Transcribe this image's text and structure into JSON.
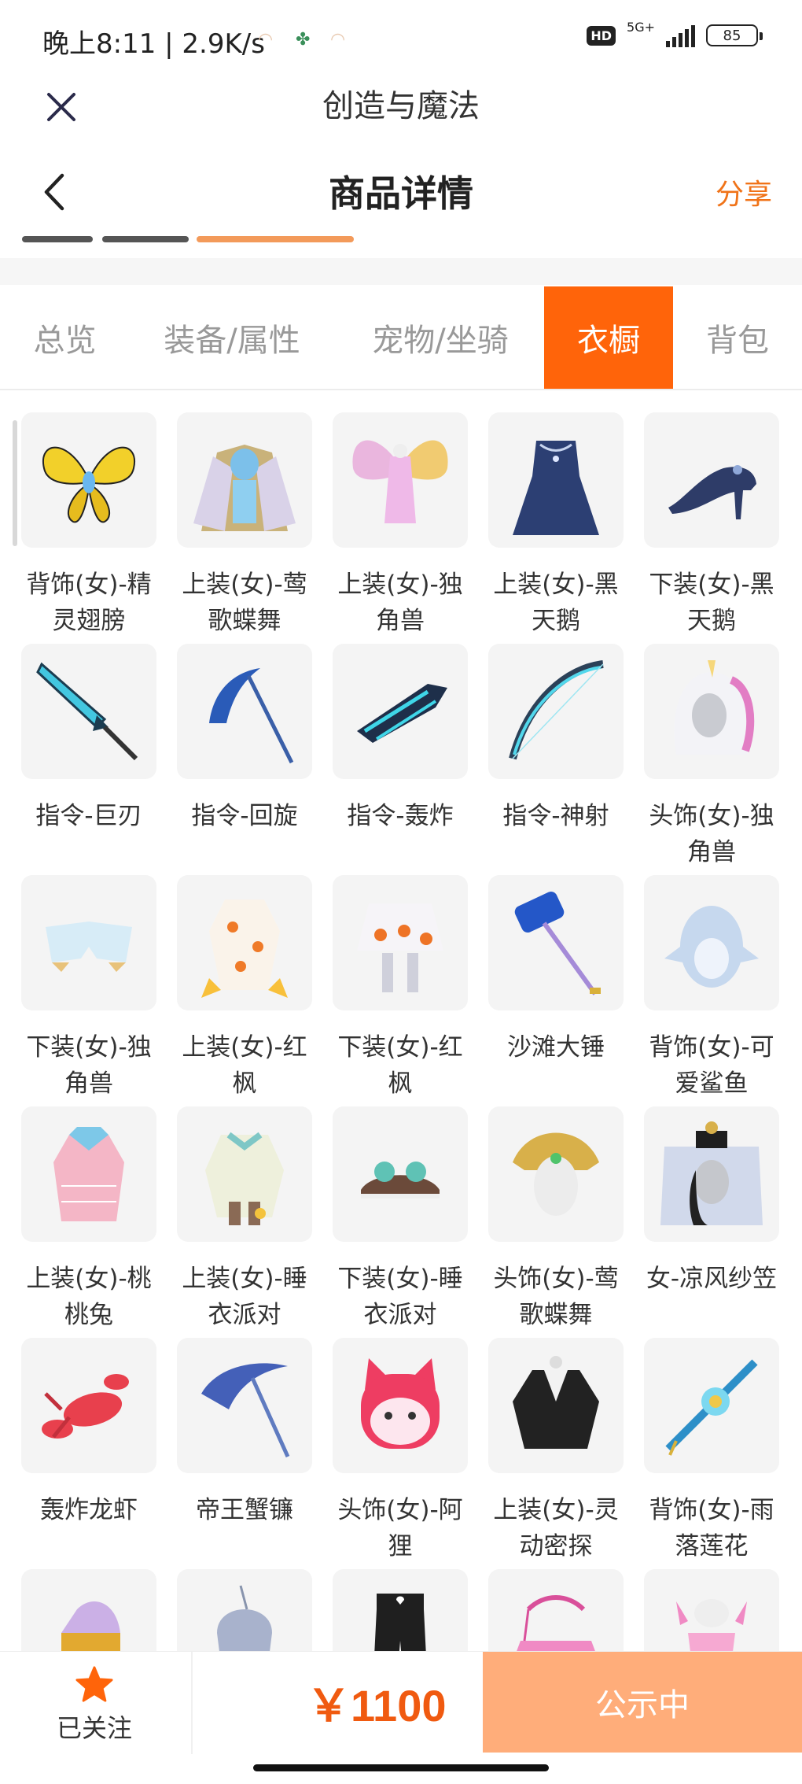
{
  "status_bar": {
    "time_speed": "晚上8:11 | 2.9K/s",
    "hd": "HD",
    "network": "5G+",
    "signal_level": 5,
    "battery": "85"
  },
  "app_bar": {
    "title": "创造与魔法",
    "close_icon": "close-icon"
  },
  "header": {
    "title": "商品详情",
    "share": "分享",
    "back_icon": "chevron-left-icon"
  },
  "tabs": [
    {
      "label": "总览",
      "active": false
    },
    {
      "label": "装备/属性",
      "active": false
    },
    {
      "label": "宠物/坐骑",
      "active": false
    },
    {
      "label": "衣橱",
      "active": true
    },
    {
      "label": "背包",
      "active": false
    }
  ],
  "accent_color": "#ff640a",
  "items": [
    {
      "name": "背饰(女)-精灵翅膀",
      "icon": "butterfly-wings-icon"
    },
    {
      "name": "上装(女)-莺歌蝶舞",
      "icon": "winged-outfit-icon"
    },
    {
      "name": "上装(女)-独角兽",
      "icon": "pink-dress-wings-icon"
    },
    {
      "name": "上装(女)-黑天鹅",
      "icon": "blue-gown-icon"
    },
    {
      "name": "下装(女)-黑天鹅",
      "icon": "high-heel-icon"
    },
    {
      "name": "指令-巨刃",
      "icon": "great-sword-icon"
    },
    {
      "name": "指令-回旋",
      "icon": "scythe-icon"
    },
    {
      "name": "指令-轰炸",
      "icon": "blaster-icon"
    },
    {
      "name": "指令-神射",
      "icon": "bow-icon"
    },
    {
      "name": "头饰(女)-独角兽",
      "icon": "unicorn-hood-icon"
    },
    {
      "name": "下装(女)-独角兽",
      "icon": "fluffy-shorts-icon"
    },
    {
      "name": "上装(女)-红枫",
      "icon": "maple-kimono-icon"
    },
    {
      "name": "下装(女)-红枫",
      "icon": "maple-skirt-icon"
    },
    {
      "name": "沙滩大锤",
      "icon": "beach-hammer-icon"
    },
    {
      "name": "背饰(女)-可爱鲨鱼",
      "icon": "shark-plush-icon"
    },
    {
      "name": "上装(女)-桃桃兔",
      "icon": "pink-bunny-dress-icon"
    },
    {
      "name": "上装(女)-睡衣派对",
      "icon": "pajama-top-icon"
    },
    {
      "name": "下装(女)-睡衣派对",
      "icon": "pajama-bottom-icon"
    },
    {
      "name": "头饰(女)-莺歌蝶舞",
      "icon": "golden-headdress-icon"
    },
    {
      "name": "女-凉风纱笠",
      "icon": "veil-hat-icon"
    },
    {
      "name": "轰炸龙虾",
      "icon": "lobster-icon"
    },
    {
      "name": "帝王蟹镰",
      "icon": "crab-scythe-icon"
    },
    {
      "name": "头饰(女)-阿狸",
      "icon": "fox-mask-icon"
    },
    {
      "name": "上装(女)-灵动密探",
      "icon": "leather-jacket-icon"
    },
    {
      "name": "背饰(女)-雨落莲花",
      "icon": "lotus-umbrella-icon"
    },
    {
      "name": "",
      "icon": "purple-cape-icon"
    },
    {
      "name": "",
      "icon": "silver-helmet-icon"
    },
    {
      "name": "",
      "icon": "black-pants-icon"
    },
    {
      "name": "",
      "icon": "pink-skirt-icon"
    },
    {
      "name": "",
      "icon": "pink-swimsuit-icon"
    }
  ],
  "bottom_bar": {
    "follow_label": "已关注",
    "follow_icon": "star-icon",
    "price": "￥1100",
    "status_button": "公示中"
  }
}
